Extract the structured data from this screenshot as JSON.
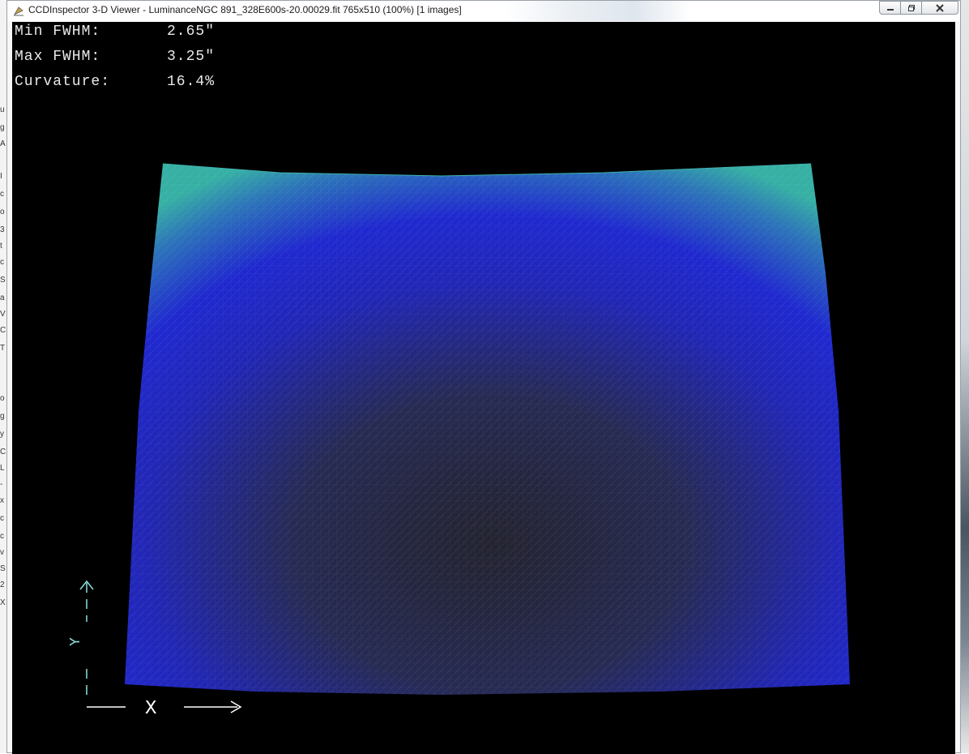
{
  "window": {
    "title": "CCDInspector 3-D Viewer - LuminanceNGC 891_328E600s-20.00029.fit 765x510 (100%)  [1 images]",
    "buttons": [
      "minimize-button",
      "maximize-button",
      "close-button"
    ]
  },
  "stats": {
    "min_fwhm": {
      "label": "Min FWHM:",
      "value": "2.65\""
    },
    "max_fwhm": {
      "label": "Max FWHM:",
      "value": "3.25\""
    },
    "curvature": {
      "label": "Curvature:",
      "value": "16.4%"
    }
  },
  "axes": {
    "x_label": "X",
    "y_label": "Y"
  },
  "colors": {
    "background": "#000000",
    "surface_low": "#232330",
    "surface_mid": "#1f22c8",
    "surface_high": "#34a8a4",
    "axis_indicator": "#8ee0e0"
  },
  "icons": [
    "app-icon",
    "minimize-icon",
    "maximize-icon",
    "close-icon"
  ]
}
